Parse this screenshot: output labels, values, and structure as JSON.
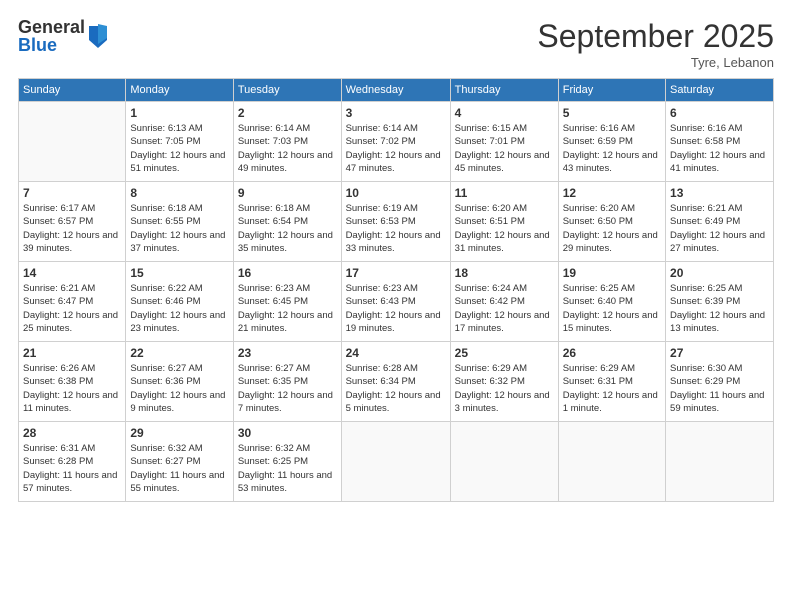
{
  "header": {
    "logo_general": "General",
    "logo_blue": "Blue",
    "month_title": "September 2025",
    "subtitle": "Tyre, Lebanon"
  },
  "days_of_week": [
    "Sunday",
    "Monday",
    "Tuesday",
    "Wednesday",
    "Thursday",
    "Friday",
    "Saturday"
  ],
  "weeks": [
    [
      {
        "day": "",
        "sunrise": "",
        "sunset": "",
        "daylight": ""
      },
      {
        "day": "1",
        "sunrise": "Sunrise: 6:13 AM",
        "sunset": "Sunset: 7:05 PM",
        "daylight": "Daylight: 12 hours and 51 minutes."
      },
      {
        "day": "2",
        "sunrise": "Sunrise: 6:14 AM",
        "sunset": "Sunset: 7:03 PM",
        "daylight": "Daylight: 12 hours and 49 minutes."
      },
      {
        "day": "3",
        "sunrise": "Sunrise: 6:14 AM",
        "sunset": "Sunset: 7:02 PM",
        "daylight": "Daylight: 12 hours and 47 minutes."
      },
      {
        "day": "4",
        "sunrise": "Sunrise: 6:15 AM",
        "sunset": "Sunset: 7:01 PM",
        "daylight": "Daylight: 12 hours and 45 minutes."
      },
      {
        "day": "5",
        "sunrise": "Sunrise: 6:16 AM",
        "sunset": "Sunset: 6:59 PM",
        "daylight": "Daylight: 12 hours and 43 minutes."
      },
      {
        "day": "6",
        "sunrise": "Sunrise: 6:16 AM",
        "sunset": "Sunset: 6:58 PM",
        "daylight": "Daylight: 12 hours and 41 minutes."
      }
    ],
    [
      {
        "day": "7",
        "sunrise": "Sunrise: 6:17 AM",
        "sunset": "Sunset: 6:57 PM",
        "daylight": "Daylight: 12 hours and 39 minutes."
      },
      {
        "day": "8",
        "sunrise": "Sunrise: 6:18 AM",
        "sunset": "Sunset: 6:55 PM",
        "daylight": "Daylight: 12 hours and 37 minutes."
      },
      {
        "day": "9",
        "sunrise": "Sunrise: 6:18 AM",
        "sunset": "Sunset: 6:54 PM",
        "daylight": "Daylight: 12 hours and 35 minutes."
      },
      {
        "day": "10",
        "sunrise": "Sunrise: 6:19 AM",
        "sunset": "Sunset: 6:53 PM",
        "daylight": "Daylight: 12 hours and 33 minutes."
      },
      {
        "day": "11",
        "sunrise": "Sunrise: 6:20 AM",
        "sunset": "Sunset: 6:51 PM",
        "daylight": "Daylight: 12 hours and 31 minutes."
      },
      {
        "day": "12",
        "sunrise": "Sunrise: 6:20 AM",
        "sunset": "Sunset: 6:50 PM",
        "daylight": "Daylight: 12 hours and 29 minutes."
      },
      {
        "day": "13",
        "sunrise": "Sunrise: 6:21 AM",
        "sunset": "Sunset: 6:49 PM",
        "daylight": "Daylight: 12 hours and 27 minutes."
      }
    ],
    [
      {
        "day": "14",
        "sunrise": "Sunrise: 6:21 AM",
        "sunset": "Sunset: 6:47 PM",
        "daylight": "Daylight: 12 hours and 25 minutes."
      },
      {
        "day": "15",
        "sunrise": "Sunrise: 6:22 AM",
        "sunset": "Sunset: 6:46 PM",
        "daylight": "Daylight: 12 hours and 23 minutes."
      },
      {
        "day": "16",
        "sunrise": "Sunrise: 6:23 AM",
        "sunset": "Sunset: 6:45 PM",
        "daylight": "Daylight: 12 hours and 21 minutes."
      },
      {
        "day": "17",
        "sunrise": "Sunrise: 6:23 AM",
        "sunset": "Sunset: 6:43 PM",
        "daylight": "Daylight: 12 hours and 19 minutes."
      },
      {
        "day": "18",
        "sunrise": "Sunrise: 6:24 AM",
        "sunset": "Sunset: 6:42 PM",
        "daylight": "Daylight: 12 hours and 17 minutes."
      },
      {
        "day": "19",
        "sunrise": "Sunrise: 6:25 AM",
        "sunset": "Sunset: 6:40 PM",
        "daylight": "Daylight: 12 hours and 15 minutes."
      },
      {
        "day": "20",
        "sunrise": "Sunrise: 6:25 AM",
        "sunset": "Sunset: 6:39 PM",
        "daylight": "Daylight: 12 hours and 13 minutes."
      }
    ],
    [
      {
        "day": "21",
        "sunrise": "Sunrise: 6:26 AM",
        "sunset": "Sunset: 6:38 PM",
        "daylight": "Daylight: 12 hours and 11 minutes."
      },
      {
        "day": "22",
        "sunrise": "Sunrise: 6:27 AM",
        "sunset": "Sunset: 6:36 PM",
        "daylight": "Daylight: 12 hours and 9 minutes."
      },
      {
        "day": "23",
        "sunrise": "Sunrise: 6:27 AM",
        "sunset": "Sunset: 6:35 PM",
        "daylight": "Daylight: 12 hours and 7 minutes."
      },
      {
        "day": "24",
        "sunrise": "Sunrise: 6:28 AM",
        "sunset": "Sunset: 6:34 PM",
        "daylight": "Daylight: 12 hours and 5 minutes."
      },
      {
        "day": "25",
        "sunrise": "Sunrise: 6:29 AM",
        "sunset": "Sunset: 6:32 PM",
        "daylight": "Daylight: 12 hours and 3 minutes."
      },
      {
        "day": "26",
        "sunrise": "Sunrise: 6:29 AM",
        "sunset": "Sunset: 6:31 PM",
        "daylight": "Daylight: 12 hours and 1 minute."
      },
      {
        "day": "27",
        "sunrise": "Sunrise: 6:30 AM",
        "sunset": "Sunset: 6:29 PM",
        "daylight": "Daylight: 11 hours and 59 minutes."
      }
    ],
    [
      {
        "day": "28",
        "sunrise": "Sunrise: 6:31 AM",
        "sunset": "Sunset: 6:28 PM",
        "daylight": "Daylight: 11 hours and 57 minutes."
      },
      {
        "day": "29",
        "sunrise": "Sunrise: 6:32 AM",
        "sunset": "Sunset: 6:27 PM",
        "daylight": "Daylight: 11 hours and 55 minutes."
      },
      {
        "day": "30",
        "sunrise": "Sunrise: 6:32 AM",
        "sunset": "Sunset: 6:25 PM",
        "daylight": "Daylight: 11 hours and 53 minutes."
      },
      {
        "day": "",
        "sunrise": "",
        "sunset": "",
        "daylight": ""
      },
      {
        "day": "",
        "sunrise": "",
        "sunset": "",
        "daylight": ""
      },
      {
        "day": "",
        "sunrise": "",
        "sunset": "",
        "daylight": ""
      },
      {
        "day": "",
        "sunrise": "",
        "sunset": "",
        "daylight": ""
      }
    ]
  ]
}
